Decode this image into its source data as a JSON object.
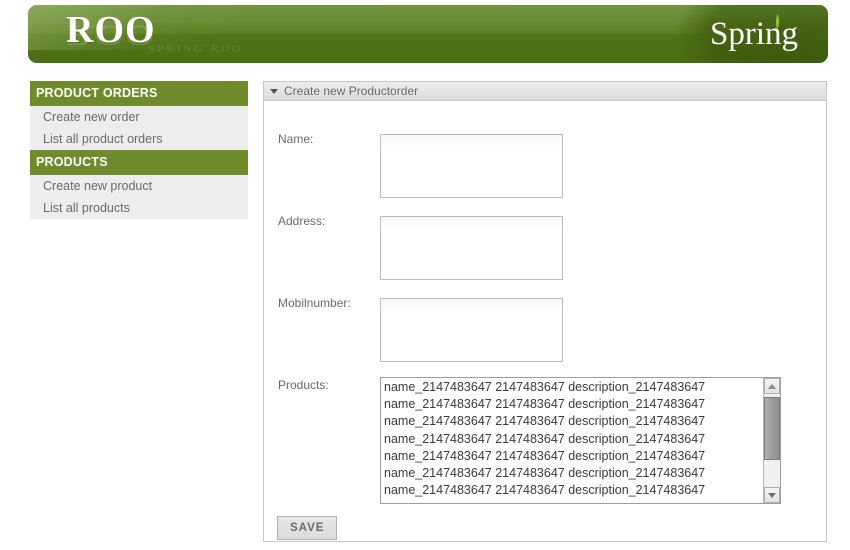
{
  "header": {
    "app_logo": "ROO",
    "app_logo_sub": "SPRING ROO",
    "brand": "Spring",
    "leaf_icon": "leaf-icon",
    "banner_color": "#4e7412",
    "banner_dark_color": "#3e5f0c"
  },
  "sidebar": {
    "sections": [
      {
        "title": "PRODUCT ORDERS",
        "items": [
          {
            "label": "Create new order"
          },
          {
            "label": "List all product orders"
          }
        ]
      },
      {
        "title": "PRODUCTS",
        "items": [
          {
            "label": "Create new product"
          },
          {
            "label": "List all products"
          }
        ]
      }
    ],
    "header_color": "#6f8b2b",
    "background_color": "#ededed"
  },
  "panel": {
    "title": "Create new Productorder",
    "toggle_icon": "triangle-down-icon",
    "fields": [
      {
        "label": "Name:",
        "value": "",
        "type": "textarea"
      },
      {
        "label": "Address:",
        "value": "",
        "type": "textarea"
      },
      {
        "label": "Mobilnumber:",
        "value": "",
        "type": "textarea"
      },
      {
        "label": "Products:",
        "value": "",
        "type": "listbox"
      }
    ],
    "products": {
      "label": "Products:",
      "options": [
        "name_2147483647 2147483647 description_2147483647",
        "name_2147483647 2147483647 description_2147483647",
        "name_2147483647 2147483647 description_2147483647",
        "name_2147483647 2147483647 description_2147483647",
        "name_2147483647 2147483647 description_2147483647",
        "name_2147483647 2147483647 description_2147483647",
        "name_2147483647 2147483647 description_2147483647"
      ],
      "scroll_up_icon": "arrow-up-icon",
      "scroll_down_icon": "arrow-down-icon"
    },
    "save_label": "SAVE"
  }
}
